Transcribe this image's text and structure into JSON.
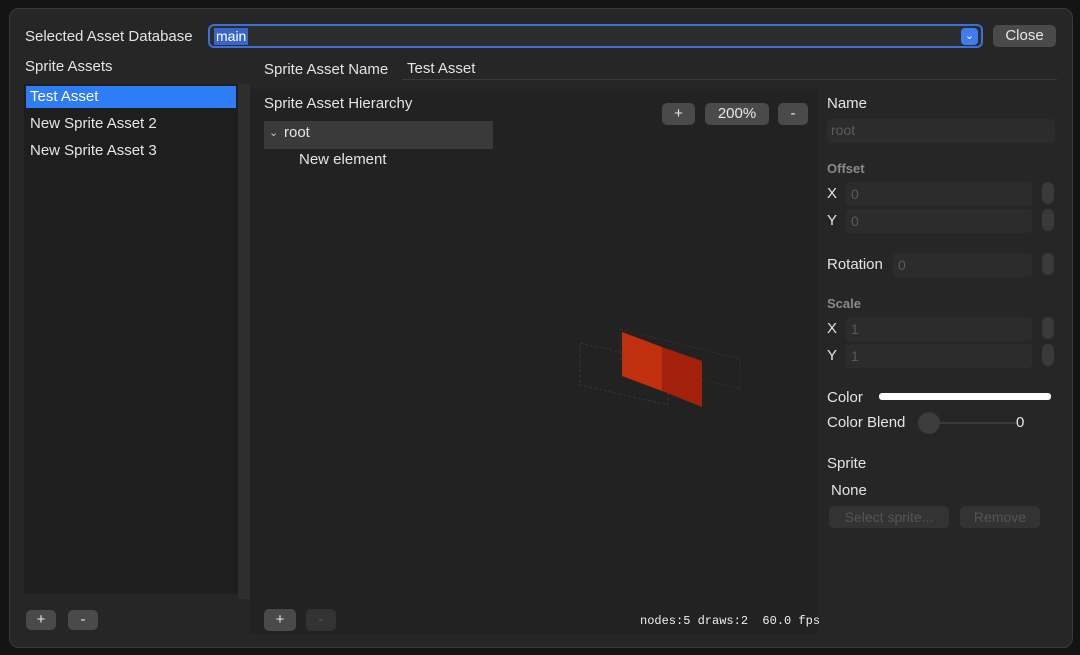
{
  "header": {
    "db_label": "Selected Asset Database",
    "db_value": "main",
    "close_label": "Close"
  },
  "sprite_assets": {
    "title": "Sprite Assets",
    "items": [
      "Test Asset",
      "New Sprite Asset 2",
      "New Sprite Asset 3"
    ],
    "add_label": "+",
    "remove_label": "-"
  },
  "asset": {
    "name_label": "Sprite Asset Name",
    "name_value": "Test Asset",
    "hierarchy_label": "Sprite Asset Hierarchy",
    "root_label": "root",
    "child_label": "New element",
    "add_label": "+",
    "remove_label": "-"
  },
  "viewport": {
    "zoom_in": "+",
    "zoom_level": "200%",
    "zoom_out": "-",
    "stats": "nodes:5 draws:2  60.0 fps"
  },
  "inspector": {
    "name_label": "Name",
    "name_placeholder": "root",
    "offset_label": "Offset",
    "offset_x_label": "X",
    "offset_x": "0",
    "offset_y_label": "Y",
    "offset_y": "0",
    "rotation_label": "Rotation",
    "rotation": "0",
    "scale_label": "Scale",
    "scale_x_label": "X",
    "scale_x": "1",
    "scale_y_label": "Y",
    "scale_y": "1",
    "color_label": "Color",
    "color_value": "#ffffff",
    "blend_label": "Color Blend",
    "blend_value": "0",
    "sprite_label": "Sprite",
    "sprite_value": "None",
    "select_sprite_label": "Select sprite...",
    "remove_label": "Remove"
  },
  "colors": {
    "accent": "#2e7cf6",
    "sprite_red": "#b8280f"
  }
}
